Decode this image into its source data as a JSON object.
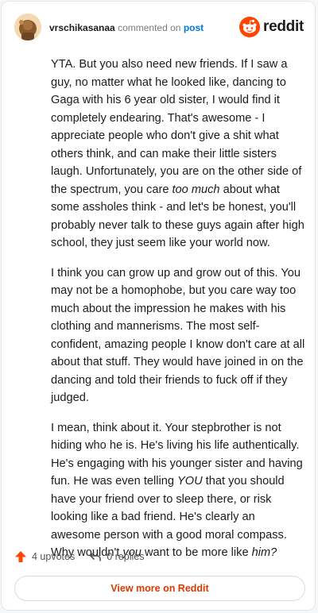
{
  "header": {
    "username": "vrschikasanaa",
    "action_text": "commented on",
    "post_link": "post",
    "brand_name": "reddit"
  },
  "colors": {
    "brand_orange": "#ff4500",
    "upvote_orange": "#ff4500",
    "link_blue": "#0079d3",
    "view_more": "#d93a00"
  },
  "comment": {
    "paragraphs": [
      [
        {
          "text": "YTA. But you also need new friends. If I saw a guy, no matter what he looked like, dancing to Gaga with his 6 year old sister, I would find it completely endearing. That's awesome - I appreciate people who don't give a shit what others think, and can make their little sisters laugh. Unfortunately, you are on the other side of the spectrum, you care ",
          "italic": false
        },
        {
          "text": "too much",
          "italic": true
        },
        {
          "text": " about what some assholes think - and let's be honest, you'll probably never talk to these guys again after high school, they just seem like your world now.",
          "italic": false
        }
      ],
      [
        {
          "text": "I think you can grow up and grow out of this. You may not be a homophobe, but you care way too much about the impression he makes with his clothing and mannerisms. The most self-confident, amazing people I know don't care at all about that stuff. They would have joined in on the dancing and told their friends to fuck off if they judged.",
          "italic": false
        }
      ],
      [
        {
          "text": "I mean, think about it. Your stepbrother is not hiding who he is. He's living his life authentically. He's engaging with his younger sister and having fun. He was even telling ",
          "italic": false
        },
        {
          "text": "YOU",
          "italic": true
        },
        {
          "text": " that you should have your friend over to sleep there, or risk looking like a bad friend. He's clearly an awesome person with a good moral compass. Why wouldn't ",
          "italic": false
        },
        {
          "text": "you",
          "italic": true
        },
        {
          "text": " want to be more like ",
          "italic": false
        },
        {
          "text": "him?",
          "italic": true
        }
      ]
    ]
  },
  "footer": {
    "upvotes_label": "4 upvotes",
    "upvote_icon": "upvote-arrow-icon",
    "replies_label": "0 replies",
    "reply_icon": "reply-arrow-icon"
  },
  "view_more": {
    "label": "View more on Reddit"
  }
}
